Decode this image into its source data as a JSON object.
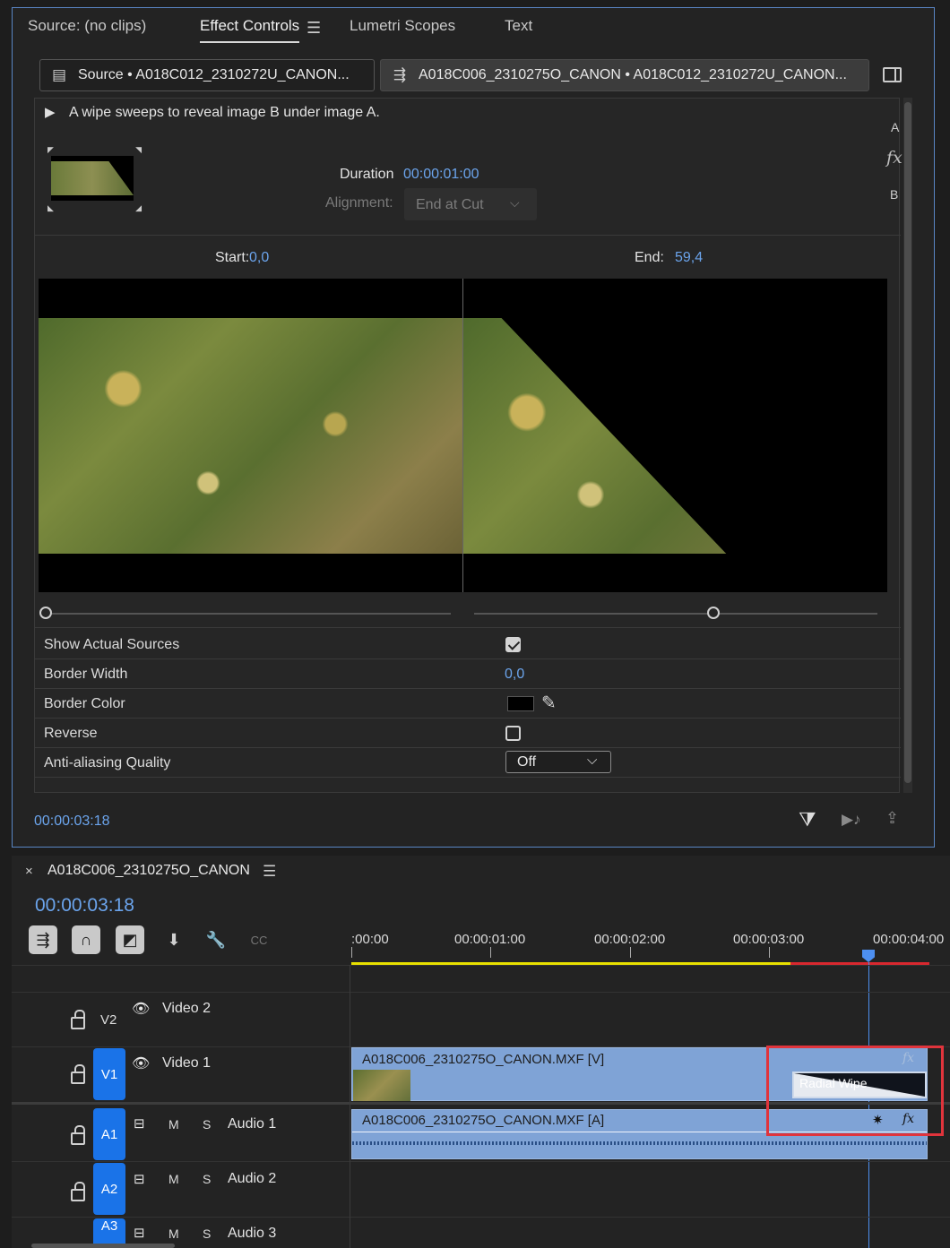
{
  "effect_controls": {
    "tabs": [
      "Source: (no clips)",
      "Effect Controls",
      "Lumetri Scopes",
      "Text"
    ],
    "source_label": "Source • A018C012_2310272U_CANON...",
    "sequence_clip_label": "A018C006_2310275O_CANON • A018C012_2310272U_CANON...",
    "description": "A wipe sweeps to reveal image B under image A.",
    "side_labels": {
      "a": "A",
      "fx": "fx",
      "b": "B"
    },
    "duration_label": "Duration",
    "duration_value": "00:00:01:00",
    "alignment_label": "Alignment:",
    "alignment_value": "End at Cut",
    "start_label": "Start:",
    "start_value": "0,0",
    "end_label": "End:",
    "end_value": "59,4",
    "start_slider": 0.0,
    "end_slider": 0.594,
    "properties": [
      {
        "name": "Show Actual Sources",
        "type": "checkbox",
        "checked": true
      },
      {
        "name": "Border Width",
        "type": "value",
        "value": "0,0"
      },
      {
        "name": "Border Color",
        "type": "color",
        "value": "#000000"
      },
      {
        "name": "Reverse",
        "type": "checkbox",
        "checked": false
      },
      {
        "name": "Anti-aliasing Quality",
        "type": "select",
        "value": "Off"
      }
    ],
    "timecode": "00:00:03:18"
  },
  "timeline": {
    "sequence_name": "A018C006_2310275O_CANON",
    "timecode": "00:00:03:18",
    "ruler_labels": [
      ":00:00",
      "00:00:01:00",
      "00:00:02:00",
      "00:00:03:00",
      "00:00:04:00"
    ],
    "tracks": [
      {
        "id": "V2",
        "name": "Video 2"
      },
      {
        "id": "V1",
        "name": "Video 1"
      },
      {
        "id": "A1",
        "name": "Audio 1",
        "m": "M",
        "s": "S"
      },
      {
        "id": "A2",
        "name": "Audio 2",
        "m": "M",
        "s": "S"
      },
      {
        "id": "A3",
        "name": "Audio 3",
        "m": "M",
        "s": "S"
      }
    ],
    "video_clip": "A018C006_2310275O_CANON.MXF [V]",
    "audio_clip": "A018C006_2310275O_CANON.MXF [A]",
    "transition": "Radial Wipe",
    "fx_label": "fx"
  },
  "colors": {
    "accent_blue": "#6ba4ec",
    "target_blue": "#1a73e8",
    "clip_blue": "#7fa3d6",
    "highlight_red": "#e0343c",
    "work_area_yellow": "#e8e000",
    "render_red": "#d8282f"
  }
}
